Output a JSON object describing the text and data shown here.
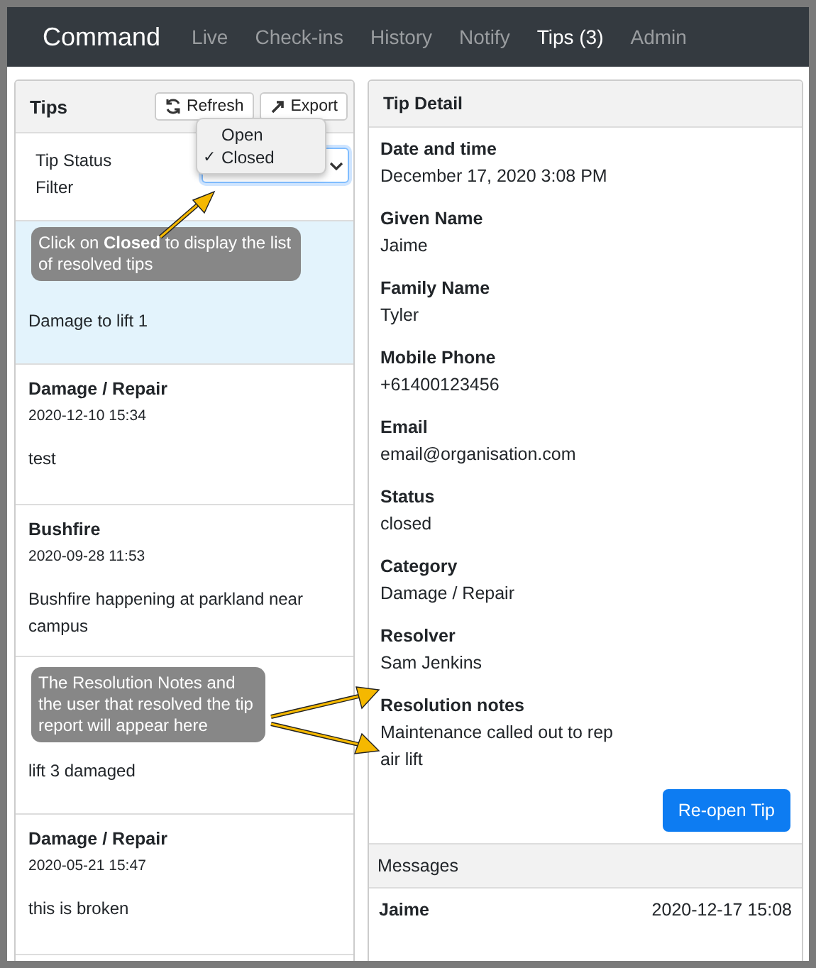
{
  "navbar": {
    "brand": "Command",
    "links": [
      {
        "label": "Live",
        "selected": false
      },
      {
        "label": "Check-ins",
        "selected": false
      },
      {
        "label": "History",
        "selected": false
      },
      {
        "label": "Notify",
        "selected": false
      },
      {
        "label": "Tips (3)",
        "selected": true
      },
      {
        "label": "Admin",
        "selected": false
      }
    ]
  },
  "tips_panel": {
    "title": "Tips",
    "buttons": [
      {
        "label": "Refresh",
        "kind": "refresh"
      },
      {
        "label": "Export",
        "kind": "export"
      }
    ],
    "filter": {
      "label": "Tip Status Filter",
      "check_mark": "✓",
      "options": [
        {
          "label": "Open",
          "checked": false
        },
        {
          "label": "Closed",
          "checked": true
        }
      ]
    },
    "items": [
      {
        "text": "Damage to lift 1",
        "selected": true
      },
      {
        "title": "Damage / Repair",
        "time": "2020-12-10 15:34",
        "text": "test",
        "selected": false
      },
      {
        "title": "Bushfire",
        "time": "2020-09-28 11:53",
        "text": "Bushfire happening at parkland near campus",
        "selected": false
      },
      {
        "text": "lift 3 damaged",
        "selected": false
      },
      {
        "title": "Damage / Repair",
        "time": "2020-05-21 15:47",
        "text": "this is broken",
        "selected": false
      }
    ]
  },
  "detail": {
    "title": "Tip Detail",
    "fields": [
      {
        "label": "Date and time",
        "value": "December 17, 2020 3:08 PM"
      },
      {
        "label": "Given Name",
        "value": "Jaime"
      },
      {
        "label": "Family Name",
        "value": "Tyler"
      },
      {
        "label": "Mobile Phone",
        "value": "+61400123456"
      },
      {
        "label": "Email",
        "value": "email@organisation.com"
      },
      {
        "label": "Status",
        "value": "closed"
      },
      {
        "label": "Category",
        "value": "Damage / Repair"
      },
      {
        "label": "Resolver",
        "value": "Sam Jenkins"
      },
      {
        "label": "Resolution notes",
        "value": "Maintenance called out to rep\nair lift"
      }
    ],
    "button": "Re-open Tip",
    "messages": {
      "title": "Messages",
      "rows": [
        {
          "sender": "Jaime",
          "time": "2020-12-17 15:08"
        }
      ]
    }
  },
  "callouts": [
    {
      "text": "Click on **Closed** to display the list of resolved tips"
    },
    {
      "text": "The Resolution Notes and the user that resolved the tip report will appear here"
    }
  ]
}
